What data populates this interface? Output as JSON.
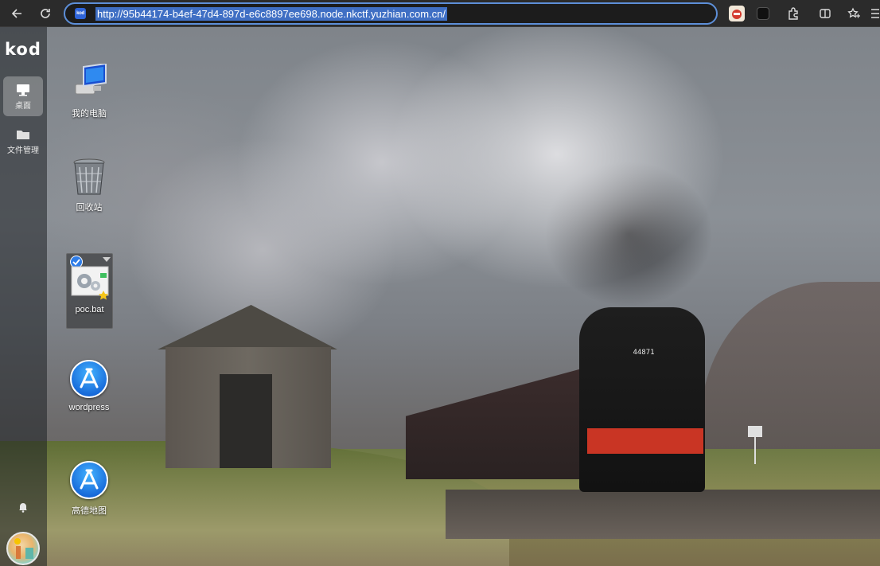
{
  "browser": {
    "url": "http://95b44174-b4ef-47d4-897d-e6c8897ee698.node.nkctf.yuzhian.com.cn/",
    "site_icon_text": "kod",
    "buttons": [
      "back-icon",
      "refresh-icon",
      "extension-icon",
      "split-screen-icon",
      "favorites-icon",
      "collections-icon"
    ]
  },
  "sidebar": {
    "logo": "kod",
    "items": [
      {
        "label": "桌面",
        "icon": "monitor-icon",
        "active": true
      },
      {
        "label": "文件管理",
        "icon": "folder-icon",
        "active": false
      }
    ],
    "bottom": [
      "bell-icon",
      "avatar"
    ]
  },
  "desktop": {
    "icons": [
      {
        "label": "我的电脑",
        "icon": "computer-icon"
      },
      {
        "label": "回收站",
        "icon": "recycle-bin-icon"
      },
      {
        "label": "poc.bat",
        "icon": "bat-file-icon",
        "selected": true
      },
      {
        "label": "wordpress",
        "icon": "app-store-icon"
      },
      {
        "label": "高德地图",
        "icon": "app-store-icon"
      }
    ],
    "wallpaper": {
      "loco_number": "44871"
    }
  },
  "colors": {
    "accent": "#2f7de8",
    "address_border": "#5d8fd8",
    "url_highlight": "#3f6fc4"
  }
}
